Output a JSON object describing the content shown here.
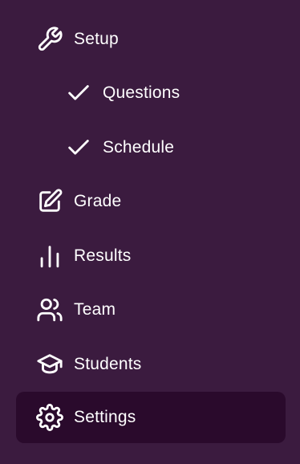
{
  "sidebar": {
    "items": [
      {
        "label": "Setup",
        "icon": "wrench-icon",
        "level": "top",
        "active": false
      },
      {
        "label": "Questions",
        "icon": "check-icon",
        "level": "sub",
        "active": false
      },
      {
        "label": "Schedule",
        "icon": "check-icon",
        "level": "sub",
        "active": false
      },
      {
        "label": "Grade",
        "icon": "edit-icon",
        "level": "top",
        "active": false
      },
      {
        "label": "Results",
        "icon": "bar-chart-icon",
        "level": "top",
        "active": false
      },
      {
        "label": "Team",
        "icon": "users-icon",
        "level": "top",
        "active": false
      },
      {
        "label": "Students",
        "icon": "graduation-cap-icon",
        "level": "top",
        "active": false
      },
      {
        "label": "Settings",
        "icon": "gear-icon",
        "level": "top",
        "active": true
      }
    ]
  },
  "colors": {
    "background": "#3b1b3f",
    "active_background": "#2a0a2c",
    "text": "#ffffff"
  }
}
